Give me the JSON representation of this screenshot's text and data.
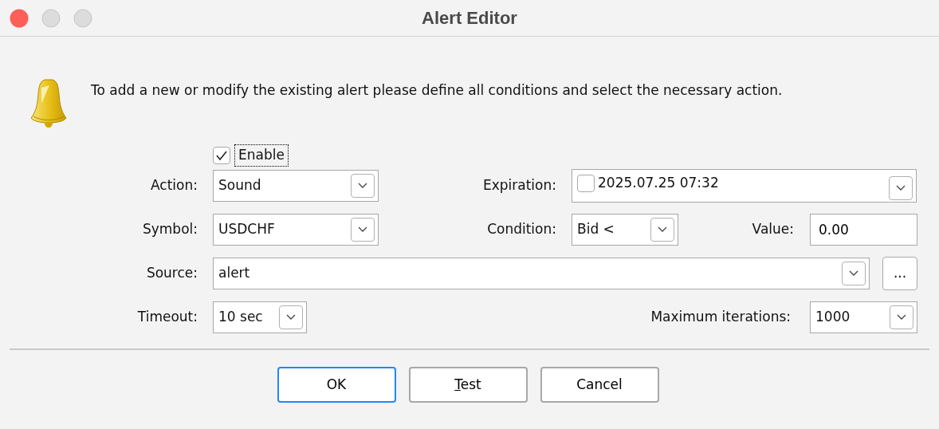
{
  "window": {
    "title": "Alert Editor"
  },
  "intro": "To add a new or modify the existing alert please define all conditions and select the necessary action.",
  "enable": {
    "label": "Enable",
    "checked": true,
    "focused": true
  },
  "action": {
    "label": "Action:",
    "value": "Sound"
  },
  "expiration": {
    "label": "Expiration:",
    "checked": false,
    "value": "2025.07.25 07:32"
  },
  "symbol": {
    "label": "Symbol:",
    "value": "USDCHF"
  },
  "condition": {
    "label": "Condition:",
    "value": "Bid <"
  },
  "value_field": {
    "label": "Value:",
    "value": "0.00"
  },
  "source": {
    "label": "Source:",
    "value": "alert"
  },
  "browse_button": "...",
  "timeout": {
    "label": "Timeout:",
    "value": "10 sec"
  },
  "max_iterations": {
    "label": "Maximum iterations:",
    "value": "1000"
  },
  "buttons": [
    {
      "label": "OK",
      "default": true,
      "mnemonic": false
    },
    {
      "label": "Test",
      "default": false,
      "mnemonic": true
    },
    {
      "label": "Cancel",
      "default": false,
      "mnemonic": false
    }
  ]
}
